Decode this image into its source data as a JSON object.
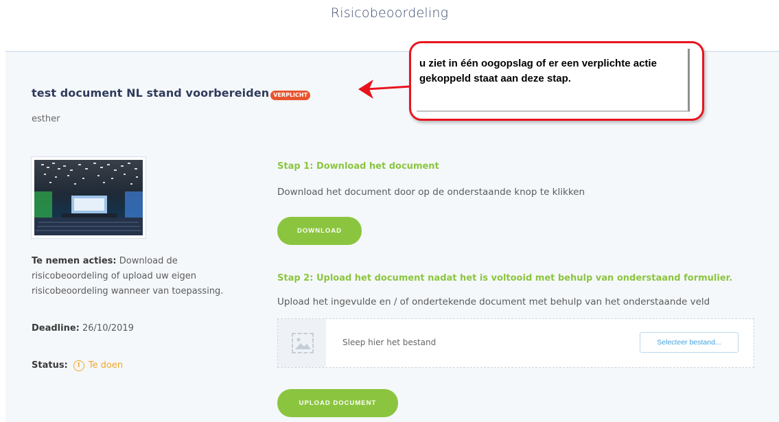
{
  "header": {
    "title": "Risicobeoordeling"
  },
  "document": {
    "title": "test document NL stand voorbereiden",
    "badge": "VERPLICHT",
    "author": "esther"
  },
  "info": {
    "actions_label": "Te nemen acties:",
    "actions_text": " Download de risicobeoordeling of upload uw eigen risicobeoordeling wanneer van toepassing.",
    "deadline_label": "Deadline:",
    "deadline_value": " 26/10/2019",
    "status_label": "Status:",
    "status_value": "Te doen",
    "status_icon": "!"
  },
  "step1": {
    "title": "Stap 1: Download het document",
    "description": "Download het document door op de onderstaande knop te klikken",
    "button": "DOWNLOAD"
  },
  "step2": {
    "title": "Stap 2: Upload het document nadat het is voltooid met behulp van onderstaand formulier.",
    "description": "Upload het ingevulde en / of ondertekende document met behulp van het onderstaande veld",
    "dropzone_text": "Sleep hier het bestand",
    "select_button": "Selecteer bestand...",
    "upload_button": "UPLOAD DOCUMENT"
  },
  "callout": {
    "text": "u ziet in één oogopslag of er een verplichte actie gekoppeld staat aan deze stap."
  },
  "colors": {
    "accent_green": "#8bc53f",
    "badge_red": "#e8542e",
    "status_orange": "#f5a623",
    "callout_red": "#e8141d",
    "title_navy": "#2f3b5a"
  },
  "icons": {
    "thumbnail": "event-hall-image",
    "dropzone": "image-placeholder-icon",
    "status": "exclamation-circle-icon",
    "arrow": "arrow-left-icon"
  }
}
